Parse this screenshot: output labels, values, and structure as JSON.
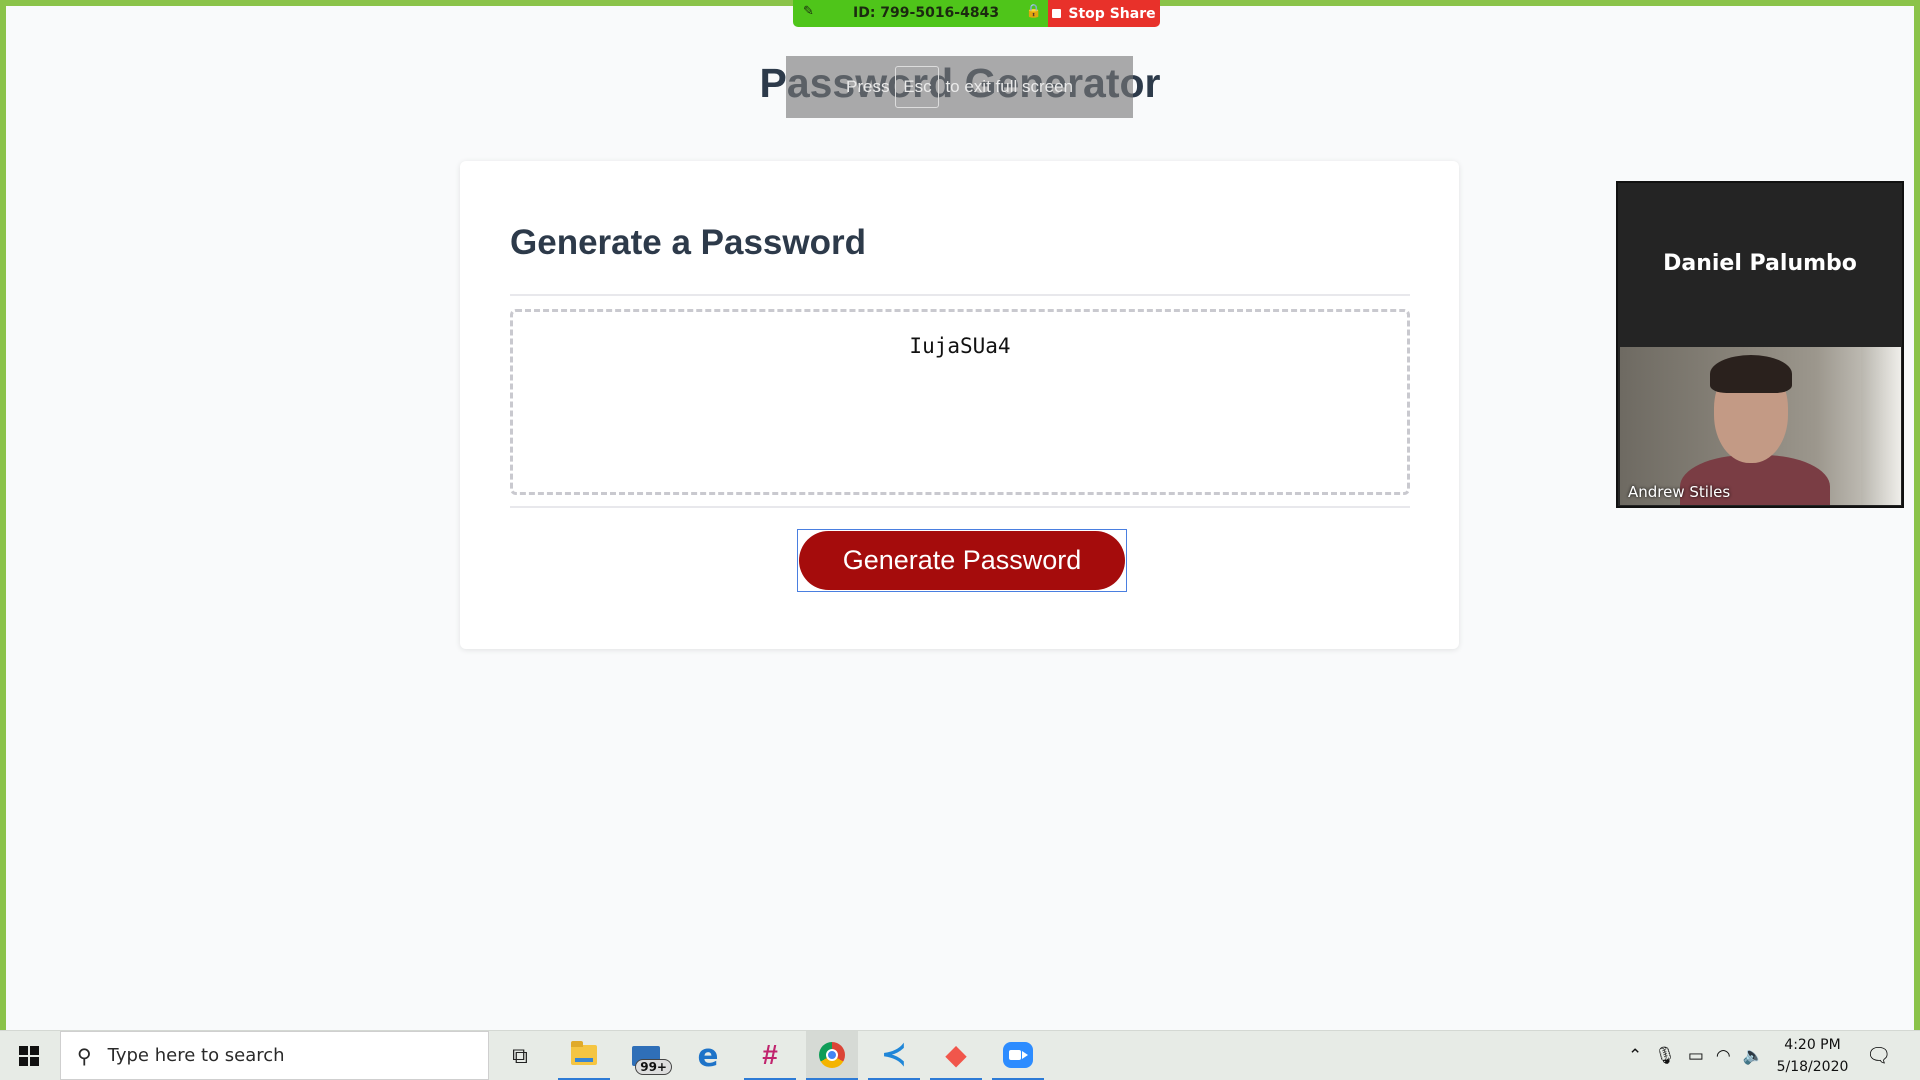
{
  "zoom_toolbar": {
    "meeting_id": "ID: 799-5016-4843",
    "stop_share_label": "Stop Share"
  },
  "page": {
    "title": "Password Generator",
    "fullscreen_hint_prefix": "Press",
    "fullscreen_hint_key": "Esc",
    "fullscreen_hint_suffix": "to exit full screen"
  },
  "card": {
    "header": "Generate a Password",
    "password_value": "IujaSUa4",
    "button_label": "Generate Password"
  },
  "video": {
    "top_participant": "Daniel Palumbo",
    "feed_participant": "Andrew Stiles"
  },
  "taskbar": {
    "search_placeholder": "Type here to search",
    "mail_badge": "99+",
    "icons": [
      "task-view-icon",
      "file-explorer-icon",
      "mail-icon",
      "edge-icon",
      "slack-icon",
      "chrome-icon",
      "vscode-icon",
      "gitkraken-icon",
      "zoom-icon"
    ],
    "time": "4:20 PM",
    "date": "5/18/2020"
  },
  "colors": {
    "share_border": "#8bc34a",
    "button_red": "#a50c0c",
    "title_text": "#2d3a4a",
    "zoom_green": "#4fc51a",
    "zoom_red": "#e8312a"
  }
}
